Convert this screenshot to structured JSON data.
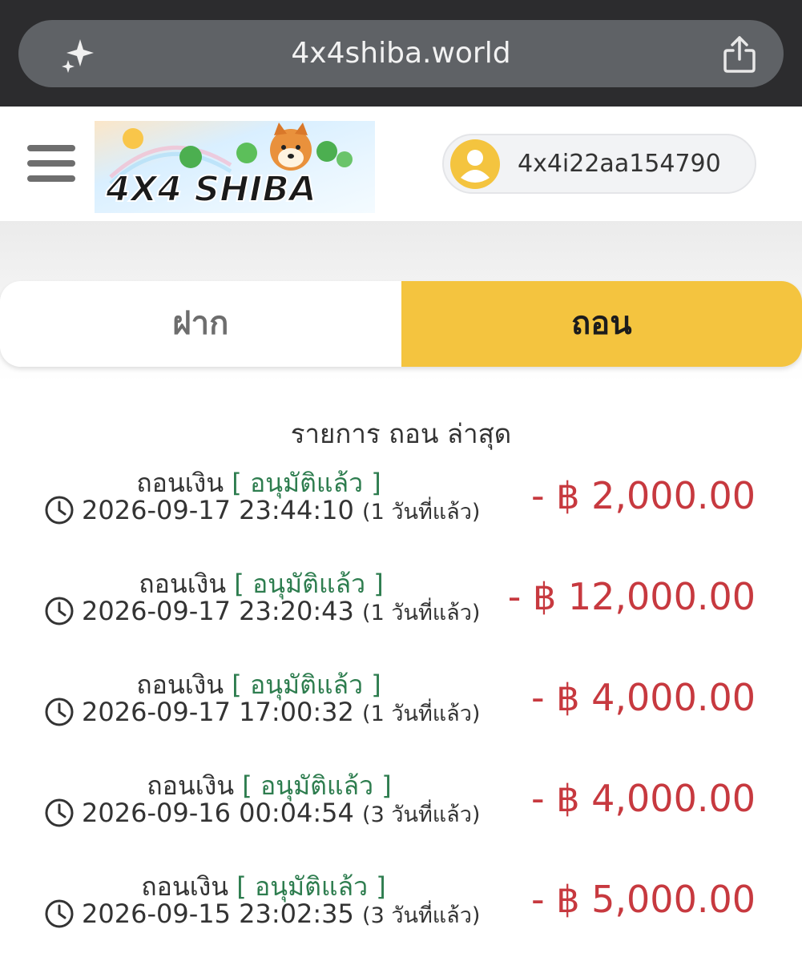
{
  "browser": {
    "url": "4x4shiba.world",
    "icons": [
      "sparkle-icon",
      "share-icon"
    ]
  },
  "header": {
    "logo_text": "4X4 SHIBA",
    "user_id": "4x4i22aa154790",
    "icons": [
      "menu-icon",
      "user-avatar-icon"
    ]
  },
  "tabs": {
    "deposit": "ฝาก",
    "withdraw": "ถอน",
    "active": "withdraw"
  },
  "list": {
    "title": "รายการ ถอน ล่าสุด",
    "items": [
      {
        "type": "ถอนเงิน",
        "status": "[ อนุมัติแล้ว ]",
        "datetime": "2026-09-17 23:44:10",
        "ago": "(1 วันที่แล้ว)",
        "amount": "- ฿ 2,000.00"
      },
      {
        "type": "ถอนเงิน",
        "status": "[ อนุมัติแล้ว ]",
        "datetime": "2026-09-17 23:20:43",
        "ago": "(1 วันที่แล้ว)",
        "amount": "- ฿ 12,000.00"
      },
      {
        "type": "ถอนเงิน",
        "status": "[ อนุมัติแล้ว ]",
        "datetime": "2026-09-17 17:00:32",
        "ago": "(1 วันที่แล้ว)",
        "amount": "- ฿ 4,000.00"
      },
      {
        "type": "ถอนเงิน",
        "status": "[ อนุมัติแล้ว ]",
        "datetime": "2026-09-16 00:04:54",
        "ago": "(3 วันที่แล้ว)",
        "amount": "- ฿ 4,000.00"
      },
      {
        "type": "ถอนเงิน",
        "status": "[ อนุมัติแล้ว ]",
        "datetime": "2026-09-15 23:02:35",
        "ago": "(3 วันที่แล้ว)",
        "amount": "- ฿ 5,000.00"
      }
    ]
  },
  "colors": {
    "active_tab": "#f4c43f",
    "amount": "#c7393f",
    "status": "#2e7d4f",
    "browser_bar": "#2c2c2e"
  }
}
